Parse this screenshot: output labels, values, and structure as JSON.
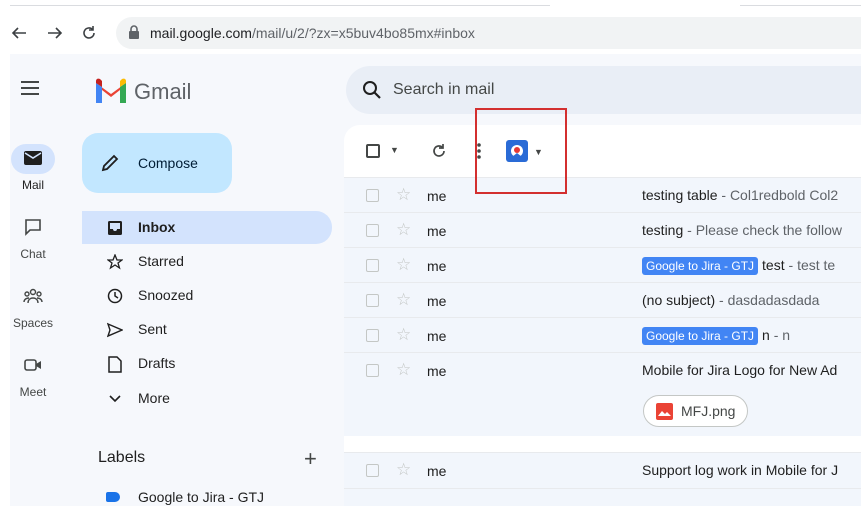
{
  "browser": {
    "url_host": "mail.google.com",
    "url_path": "/mail/u/2/?zx=x5buv4bo85mx#inbox"
  },
  "rail": {
    "items": [
      {
        "label": "Mail"
      },
      {
        "label": "Chat"
      },
      {
        "label": "Spaces"
      },
      {
        "label": "Meet"
      }
    ]
  },
  "app": {
    "name": "Gmail"
  },
  "search": {
    "placeholder": "Search in mail"
  },
  "compose": {
    "label": "Compose"
  },
  "nav": {
    "items": [
      {
        "label": "Inbox"
      },
      {
        "label": "Starred"
      },
      {
        "label": "Snoozed"
      },
      {
        "label": "Sent"
      },
      {
        "label": "Drafts"
      },
      {
        "label": "More"
      }
    ]
  },
  "labels": {
    "title": "Labels",
    "items": [
      {
        "label": "Google to Jira - GTJ"
      }
    ]
  },
  "messages": [
    {
      "sender": "me",
      "subject": "testing table",
      "snippet": " - Col1redbold Col2"
    },
    {
      "sender": "me",
      "subject": "testing",
      "snippet": " - Please check the follow"
    },
    {
      "sender": "me",
      "badge": "Google to Jira - GTJ",
      "subject": "test",
      "snippet": " - test te"
    },
    {
      "sender": "me",
      "subject": "(no subject)",
      "snippet": " - dasdadasdada"
    },
    {
      "sender": "me",
      "badge": "Google to Jira - GTJ",
      "subject": "n",
      "snippet": " - n"
    },
    {
      "sender": "me",
      "subject": "Mobile for Jira Logo for New Ad",
      "snippet": "",
      "attachment": "MFJ.png"
    },
    {
      "sender": "me",
      "subject": "Support log work in Mobile for J",
      "snippet": ""
    }
  ],
  "colors": {
    "accent": "#d3e3fd",
    "compose_bg": "#c2e7ff",
    "badge": "#4285f4",
    "highlight_box": "#d32f2f"
  }
}
